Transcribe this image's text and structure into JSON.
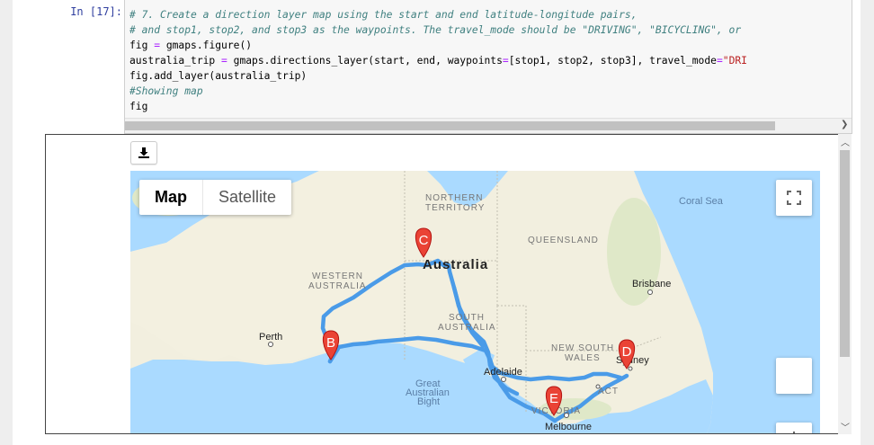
{
  "prompt": "In [17]:",
  "code": {
    "line1": "# 7. Create a direction layer map using the start and end latitude-longitude pairs,",
    "line2": "# and stop1, stop2, and stop3 as the waypoints. The travel_mode should be \"DRIVING\", \"BICYCLING\", or",
    "line3a": "fig ",
    "line3b": "=",
    "line3c": " gmaps.figure()",
    "line4a": "australia_trip ",
    "line4b": "=",
    "line4c": " gmaps.directions_layer(start, end, waypoints",
    "line4d": "=",
    "line4e": "[stop1, stop2, stop3], travel_mode",
    "line4f": "=",
    "line4g": "\"DRI",
    "line5": "fig.add_layer(australia_trip)",
    "line6": "#Showing map",
    "line7": "fig"
  },
  "map": {
    "map_type_active": "Map",
    "map_type_inactive": "Satellite",
    "labels": {
      "coral_sea": "Coral Sea",
      "northern_territory_1": "NORTHERN",
      "northern_territory_2": "TERRITORY",
      "queensland": "QUEENSLAND",
      "australia": "Australia",
      "western_australia_1": "WESTERN",
      "western_australia_2": "AUSTRALIA",
      "south_australia_1": "SOUTH",
      "south_australia_2": "AUSTRALIA",
      "brisbane": "Brisbane",
      "perth": "Perth",
      "new_south_wales_1": "NEW SOUTH",
      "new_south_wales_2": "WALES",
      "sydney": "Sydney",
      "adelaide": "Adelaide",
      "act": "ACT",
      "great_bight_1": "Great",
      "great_bight_2": "Australian",
      "great_bight_3": "Bight",
      "victoria": "VICTORIA",
      "melbourne": "Melbourne"
    },
    "markers": {
      "b": "B",
      "c": "C",
      "d": "D",
      "e": "E"
    },
    "colors": {
      "water": "#aadaff",
      "land": "#f2efdf",
      "route": "#4a9be8",
      "marker": "#ea4335"
    }
  }
}
